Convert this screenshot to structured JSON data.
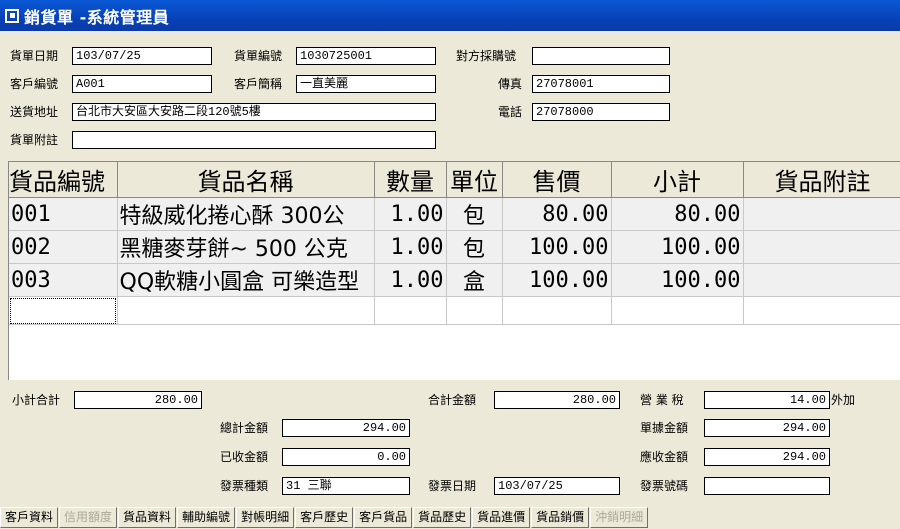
{
  "window": {
    "title": "銷貨單 -系統管理員"
  },
  "header": {
    "date_label": "貨單日期",
    "date_value": "103/07/25",
    "number_label": "貨單編號",
    "number_value": "1030725001",
    "po_label": "對方採購號",
    "po_value": "",
    "customer_id_label": "客戶編號",
    "customer_id_value": "A001",
    "customer_name_label": "客戶簡稱",
    "customer_name_value": "一直美麗",
    "fax_label": "傳真",
    "fax_value": "27078001",
    "address_label": "送貨地址",
    "address_value": "台北市大安區大安路二段120號5樓",
    "phone_label": "電話",
    "phone_value": "27078000",
    "note_label": "貨單附註",
    "note_value": ""
  },
  "grid": {
    "columns": [
      "貨品編號",
      "貨品名稱",
      "數量",
      "單位",
      "售價",
      "小計",
      "貨品附註"
    ],
    "rows": [
      {
        "code": "001",
        "name": "特級威化捲心酥 300公",
        "qty": "1.00",
        "unit": "包",
        "price": "80.00",
        "subtotal": "80.00",
        "note": ""
      },
      {
        "code": "002",
        "name": "黑糖麥芽餅~ 500 公克",
        "qty": "1.00",
        "unit": "包",
        "price": "100.00",
        "subtotal": "100.00",
        "note": ""
      },
      {
        "code": "003",
        "name": "QQ軟糖小圓盒 可樂造型",
        "qty": "1.00",
        "unit": "盒",
        "price": "100.00",
        "subtotal": "100.00",
        "note": ""
      }
    ]
  },
  "totals": {
    "subtotal_sum_label": "小計合計",
    "subtotal_sum_value": "280.00",
    "total_amount_label": "合計金額",
    "total_amount_value": "280.00",
    "tax_label": "營 業 稅",
    "tax_value": "14.00",
    "tax_suffix": "外加",
    "grand_total_label": "總計金額",
    "grand_total_value": "294.00",
    "doc_amount_label": "單據金額",
    "doc_amount_value": "294.00",
    "received_label": "已收金額",
    "received_value": "0.00",
    "receivable_label": "應收金額",
    "receivable_value": "294.00",
    "invoice_type_label": "發票種類",
    "invoice_type_value": "31 三聯",
    "invoice_date_label": "發票日期",
    "invoice_date_value": "103/07/25",
    "invoice_no_label": "發票號碼",
    "invoice_no_value": ""
  },
  "buttons": [
    {
      "label": "客戶資料",
      "enabled": true
    },
    {
      "label": "信用額度",
      "enabled": false
    },
    {
      "label": "貨品資料",
      "enabled": true
    },
    {
      "label": "輔助編號",
      "enabled": true
    },
    {
      "label": "對帳明細",
      "enabled": true
    },
    {
      "label": "客戶歷史",
      "enabled": true
    },
    {
      "label": "客戶貨品",
      "enabled": true
    },
    {
      "label": "貨品歷史",
      "enabled": true
    },
    {
      "label": "貨品進價",
      "enabled": true
    },
    {
      "label": "貨品銷價",
      "enabled": true
    },
    {
      "label": "沖銷明細",
      "enabled": false
    }
  ]
}
